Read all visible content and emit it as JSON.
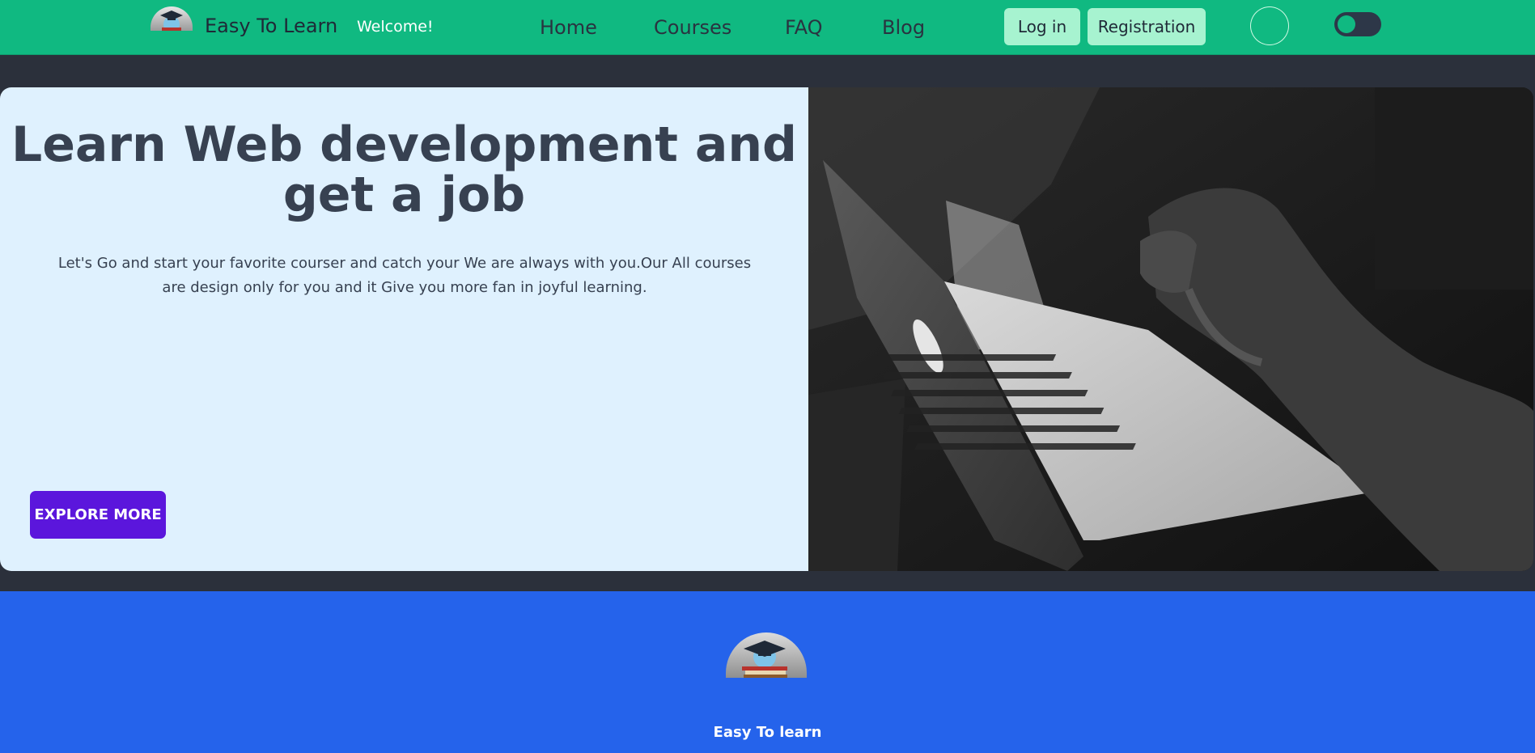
{
  "navbar": {
    "brand": "Easy To Learn",
    "welcome": "Welcome!",
    "links": [
      "Home",
      "Courses",
      "FAQ",
      "Blog"
    ],
    "login_label": "Log in",
    "register_label": "Registration"
  },
  "hero": {
    "title": "Learn Web development and get a job",
    "text": "Let's Go and start your favorite courser and catch your We are always with you.Our All courses are design only for you and it Give you more fan in joyful learning.",
    "button_label": "EXPLORE MORE"
  },
  "footer": {
    "brand": "Easy To learn"
  },
  "colors": {
    "navbar_bg": "#10b981",
    "nav_button_bg": "#a7f3d0",
    "page_bg": "#2b303b",
    "hero_bg": "#dff1fe",
    "explore_button": "#5b16dc",
    "footer_bg": "#2563eb"
  },
  "icons": {
    "logo": "graduation-cap-logo-icon",
    "avatar": "user-avatar-icon",
    "toggle": "theme-toggle-icon"
  }
}
